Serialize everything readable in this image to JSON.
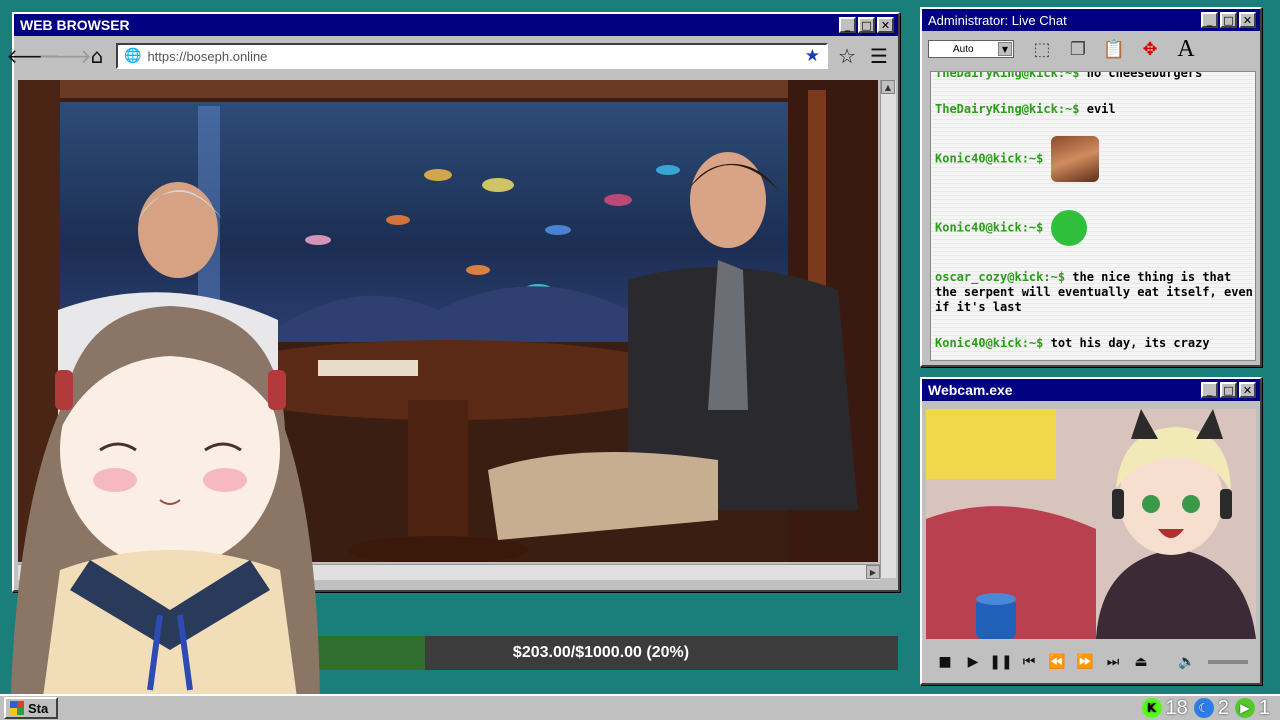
{
  "browser": {
    "title": "WEB BROWSER",
    "url": "https://boseph.online",
    "icons": {
      "back": "back-arrow-icon",
      "forward": "forward-arrow-icon",
      "home": "home-icon",
      "bookmark_filled": "star-filled-icon",
      "bookmark": "star-outline-icon",
      "menu": "hamburger-menu-icon"
    }
  },
  "donation": {
    "text": "$203.00/$1000.00 (20%)",
    "progress": 0.203
  },
  "chat": {
    "title": "Administrator: Live Chat",
    "dropdown_value": "Auto",
    "messages": [
      {
        "user": "TheDairyKing@kick:~$",
        "text": "no cheeseburgers"
      },
      {
        "user": "TheDairyKing@kick:~$",
        "text": "evil"
      },
      {
        "user": "Konic40@kick:~$",
        "text": ""
      },
      {
        "user": "Konic40@kick:~$",
        "text": ""
      },
      {
        "user": "oscar_cozy@kick:~$",
        "text": "the nice thing is that the serpent will eventually eat itself, even if it's last"
      },
      {
        "user": "Konic40@kick:~$",
        "text": "tot his day, its crazy"
      }
    ]
  },
  "webcam": {
    "title": "Webcam.exe"
  },
  "taskbar": {
    "start_label": "Sta",
    "tray": [
      {
        "icon": "kick-icon",
        "count": "18",
        "color": "#53fc18"
      },
      {
        "icon": "moon-icon",
        "count": "2",
        "color": "#2b7de9"
      },
      {
        "icon": "play-icon",
        "count": "1",
        "color": "#53c92d"
      }
    ]
  },
  "colors": {
    "desktop": "#1a7f7a",
    "titlebar": "#000080",
    "chat_username": "#2c9d1a"
  }
}
